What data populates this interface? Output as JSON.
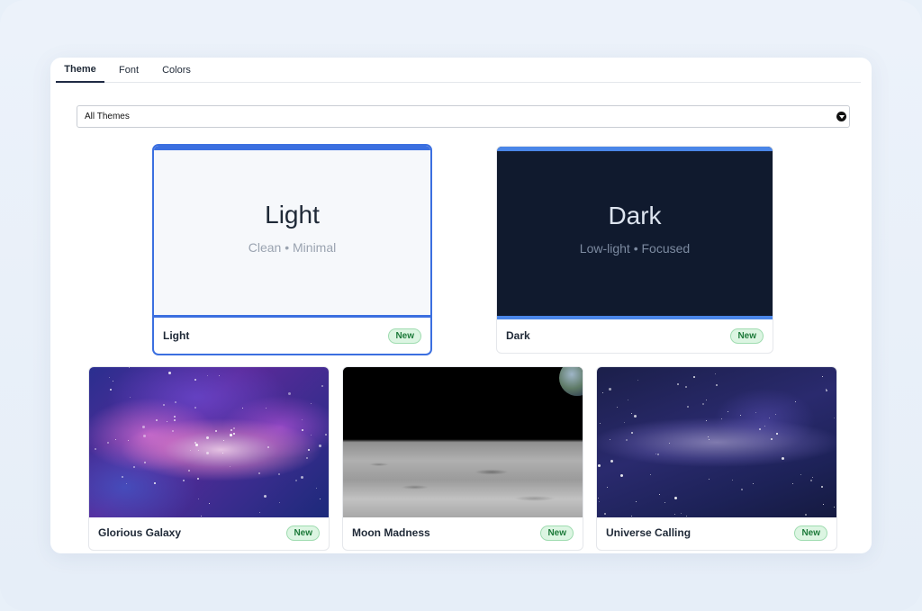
{
  "tabs": [
    {
      "label": "Theme",
      "active": true
    },
    {
      "label": "Font",
      "active": false
    },
    {
      "label": "Colors",
      "active": false
    }
  ],
  "filter": {
    "selected": "All Themes",
    "icon": "chevron-down-icon"
  },
  "themes": {
    "light": {
      "name": "Light",
      "preview_title": "Light",
      "preview_subtitle": "Clean • Minimal",
      "badge": "New",
      "selected": true
    },
    "dark": {
      "name": "Dark",
      "preview_title": "Dark",
      "preview_subtitle": "Low-light • Focused",
      "badge": "New",
      "selected": false
    },
    "galaxy": {
      "name": "Glorious Galaxy",
      "badge": "New"
    },
    "moon": {
      "name": "Moon Madness",
      "badge": "New"
    },
    "universe": {
      "name": "Universe Calling",
      "badge": "New"
    }
  },
  "colors": {
    "accent": "#3b6fe0",
    "badge_bg": "#dcf5e2",
    "badge_text": "#1d7a3a",
    "dark_preview_bg": "#101a2e"
  }
}
